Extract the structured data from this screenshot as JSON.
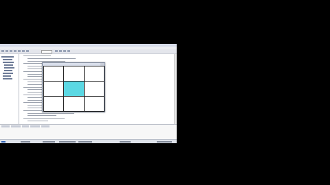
{
  "desktop": {
    "background": "#000000"
  },
  "ide": {
    "title_bar": "",
    "menu_items": [],
    "toolbar_buttons": 12,
    "sidebar_items": [
      "",
      "",
      "",
      "",
      "",
      "",
      "",
      "",
      ""
    ],
    "editor_lines": 26,
    "bottom_tabs": [
      "",
      "",
      "",
      "",
      ""
    ],
    "status_items": [
      "",
      "",
      "",
      "",
      "",
      "",
      ""
    ]
  },
  "game": {
    "title": "",
    "board": {
      "rows": 3,
      "cols": 3,
      "active_cell": [
        1,
        1
      ],
      "highlight_color": "#5bd8e3",
      "grid_color": "#1c1c1c"
    }
  }
}
